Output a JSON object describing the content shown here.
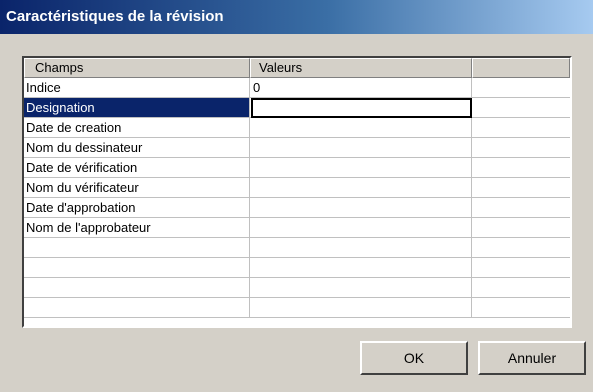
{
  "window": {
    "title": "Caractéristiques de la révision"
  },
  "grid": {
    "columns": [
      "Champs",
      "Valeurs",
      ""
    ],
    "rows": [
      {
        "field": "Indice",
        "value": "0"
      },
      {
        "field": "Designation",
        "value": ""
      },
      {
        "field": "Date de creation",
        "value": ""
      },
      {
        "field": "Nom du dessinateur",
        "value": ""
      },
      {
        "field": "Date de vérification",
        "value": ""
      },
      {
        "field": "Nom du vérificateur",
        "value": ""
      },
      {
        "field": "Date d'approbation",
        "value": ""
      },
      {
        "field": "Nom de l'approbateur",
        "value": ""
      },
      {
        "field": "",
        "value": ""
      },
      {
        "field": "",
        "value": ""
      },
      {
        "field": "",
        "value": ""
      },
      {
        "field": "",
        "value": ""
      }
    ],
    "selected_row": 1
  },
  "buttons": {
    "ok": "OK",
    "cancel": "Annuler"
  }
}
